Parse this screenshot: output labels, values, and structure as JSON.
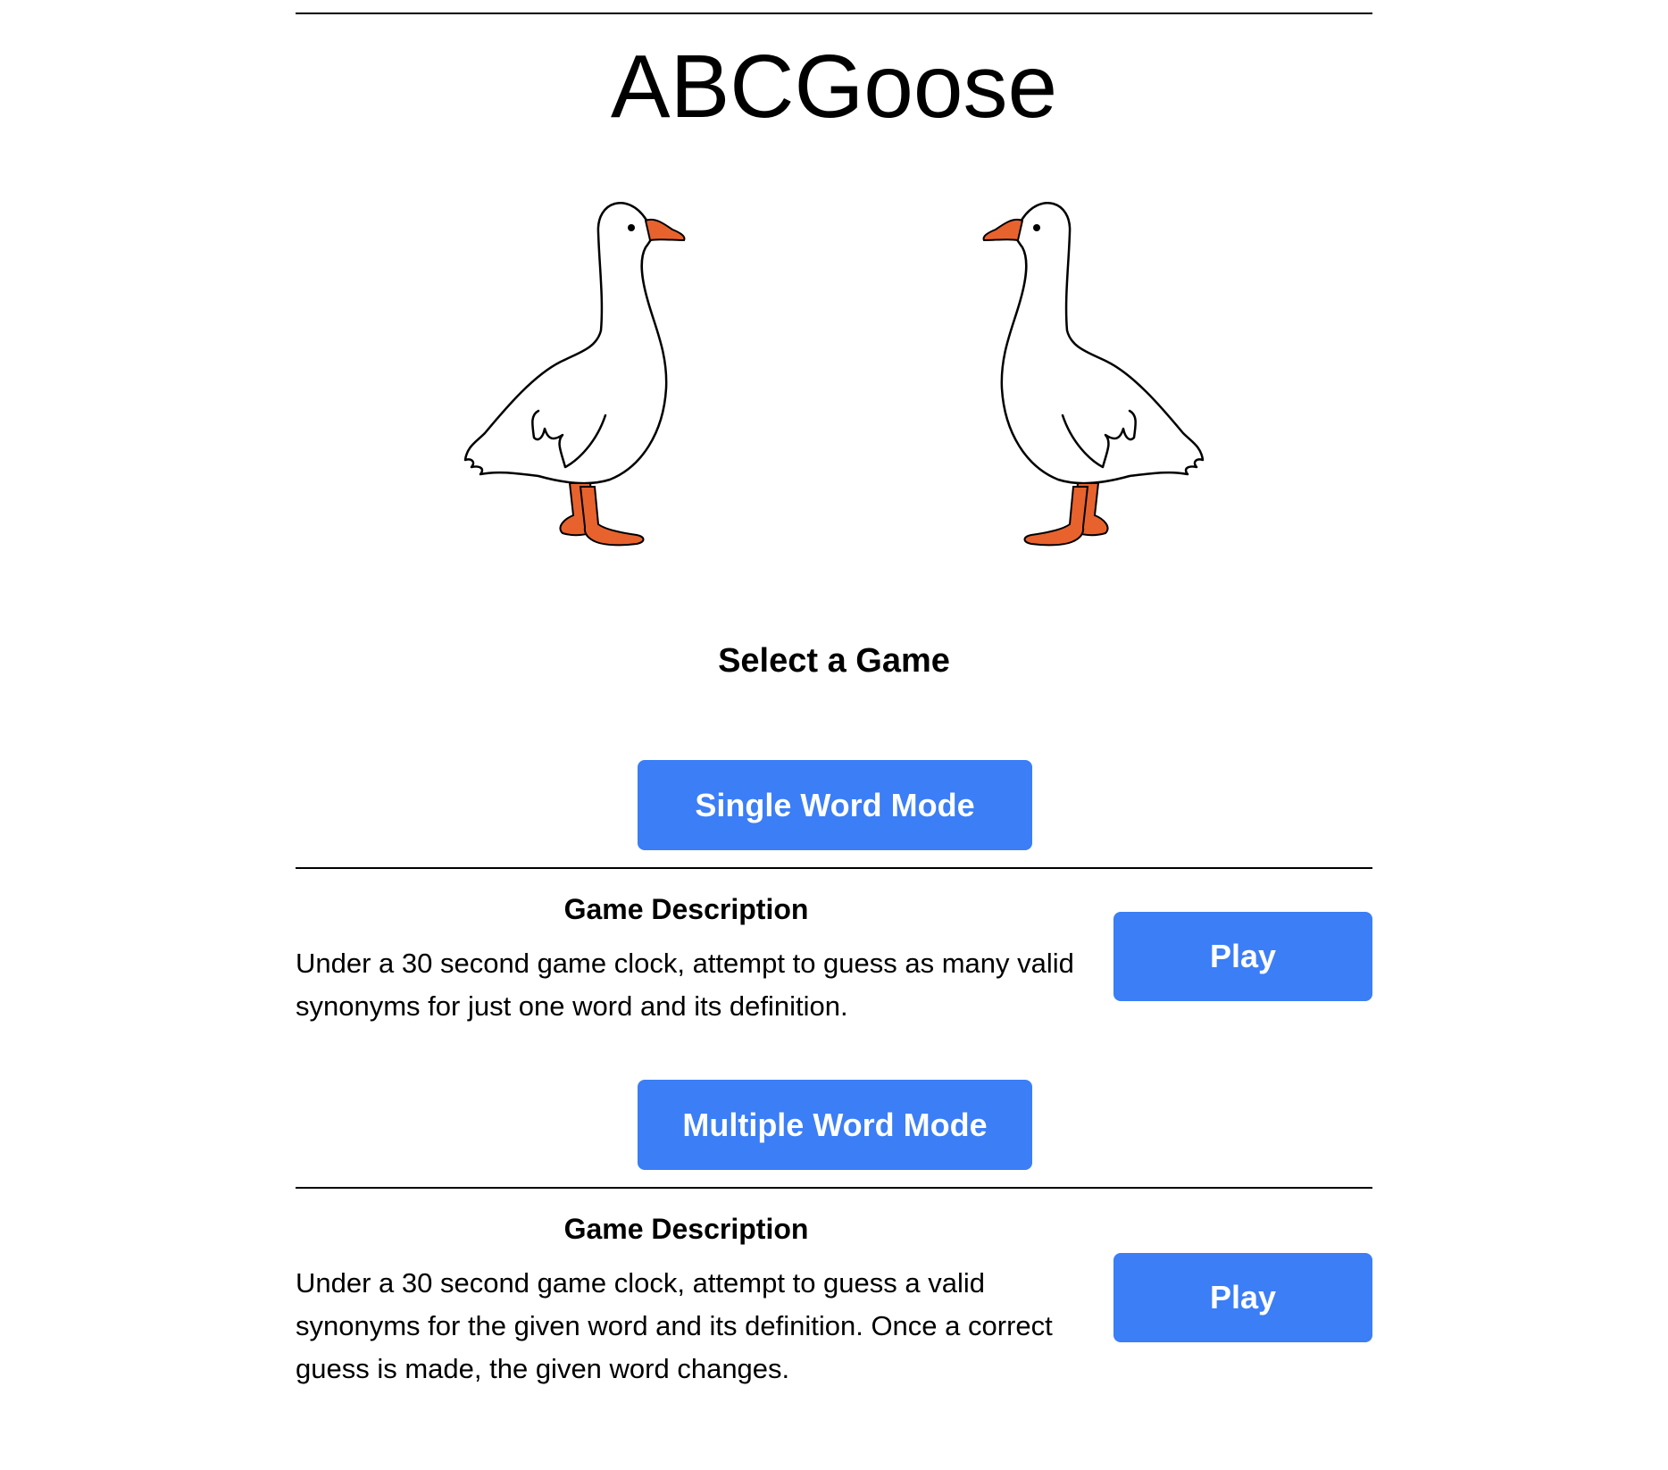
{
  "app": {
    "title": "ABCGoose"
  },
  "colors": {
    "button_bg": "#3b7ef6",
    "button_text": "#ffffff",
    "goose_beak_feet": "#e8622e",
    "rule": "#000000"
  },
  "illustration": {
    "left_icon": "goose-facing-right-icon",
    "right_icon": "goose-facing-left-icon"
  },
  "select_heading": "Select a Game",
  "games": [
    {
      "mode_label": "Single Word Mode",
      "description_title": "Game Description",
      "description": "Under a 30 second game clock, attempt to guess as many valid synonyms for just one word and its definition.",
      "play_label": "Play"
    },
    {
      "mode_label": "Multiple Word Mode",
      "description_title": "Game Description",
      "description": "Under a 30 second game clock, attempt to guess a valid synonyms for the given word and its definition. Once a correct guess is made, the given word changes.",
      "play_label": "Play"
    }
  ]
}
